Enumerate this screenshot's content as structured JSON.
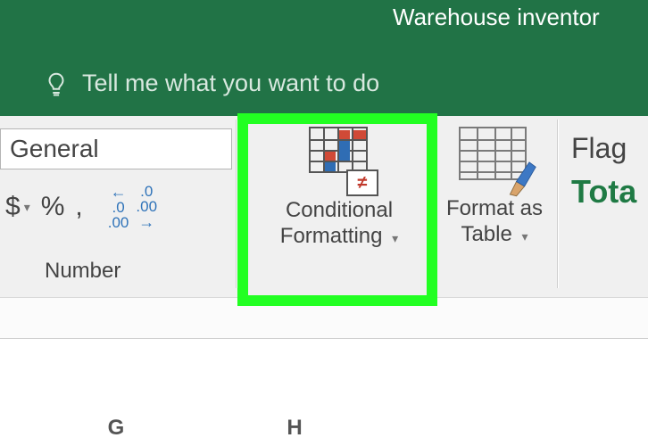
{
  "window": {
    "title": "Warehouse inventor"
  },
  "tellme": {
    "placeholder": "Tell me what you want to do"
  },
  "ribbon": {
    "number_format_value": "General",
    "number_group_label": "Number",
    "currency_symbol": "$",
    "percent_symbol": "%",
    "comma_symbol": ",",
    "inc_dec_top": ".0",
    "inc_dec_bottom": ".00",
    "conditional_label_l1": "Conditional",
    "conditional_label_l2": "Formatting",
    "formatas_label_l1": "Format as",
    "formatas_label_l2": "Table",
    "neq_glyph": "≠",
    "summary_flag": "Flag",
    "summary_total": "Tota"
  },
  "sheet": {
    "colG": "G",
    "colH": "H"
  }
}
